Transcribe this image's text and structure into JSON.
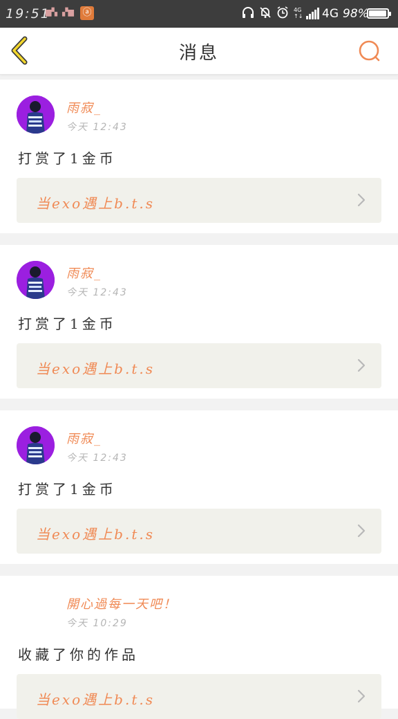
{
  "status_bar": {
    "time": "19:51",
    "network": "4G",
    "battery": "98%",
    "battery_level": 0.98,
    "notif_icons": [
      "unknown-notification-icon",
      "unknown-notification-icon"
    ],
    "app_icon": "ⓐ",
    "right_icons": [
      "headphones-icon",
      "bell-mute-icon",
      "alarm-icon",
      "4g-data-icon",
      "signal-icon",
      "battery-icon"
    ]
  },
  "navbar": {
    "title": "消息",
    "back_icon": "chevron-left-icon",
    "search_icon": "search-icon",
    "accent_color": "#f08a55"
  },
  "messages": [
    {
      "username": "雨寂_",
      "time": "今天 12:43",
      "action": "打赏了1金币",
      "work_title": "当exo遇上b.t.s",
      "has_avatar": true
    },
    {
      "username": "雨寂_",
      "time": "今天 12:43",
      "action": "打赏了1金币",
      "work_title": "当exo遇上b.t.s",
      "has_avatar": true
    },
    {
      "username": "雨寂_",
      "time": "今天 12:43",
      "action": "打赏了1金币",
      "work_title": "当exo遇上b.t.s",
      "has_avatar": true
    },
    {
      "username": "開心過每一天吧！",
      "time": "今天 10:29",
      "action": "收藏了你的作品",
      "work_title": "当exo遇上b.t.s",
      "has_avatar": false
    }
  ]
}
